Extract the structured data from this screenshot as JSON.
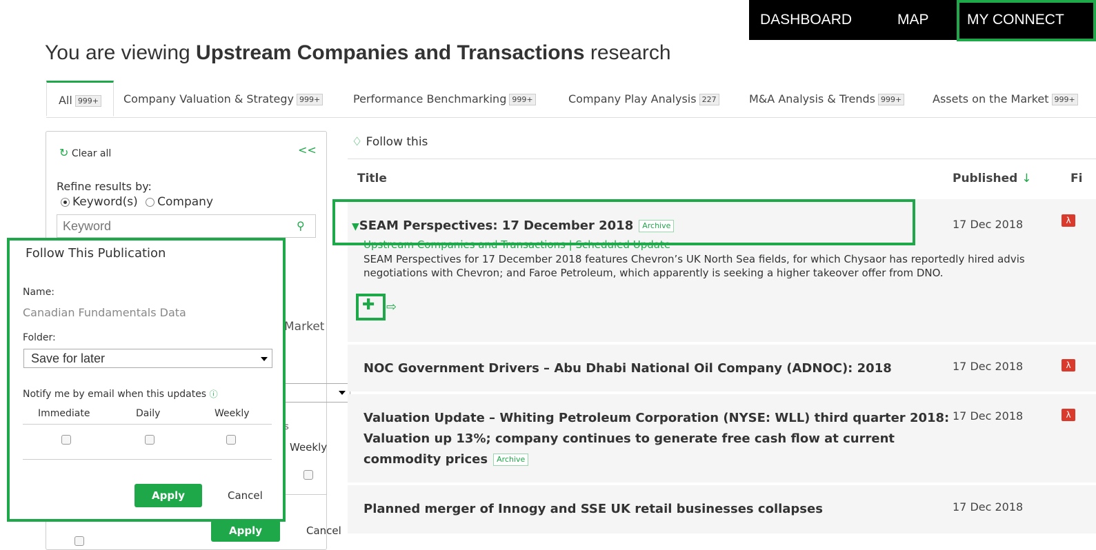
{
  "topnav": {
    "dashboard": "DASHBOARD",
    "map": "MAP",
    "my_connect": "MY CONNECT"
  },
  "heading": {
    "prefix": "You are viewing ",
    "bold": "Upstream Companies and Transactions",
    "suffix": " research"
  },
  "tabs": [
    {
      "label": "All",
      "count": "999+"
    },
    {
      "label": "Company Valuation & Strategy",
      "count": "999+"
    },
    {
      "label": "Performance Benchmarking",
      "count": "999+"
    },
    {
      "label": "Company Play Analysis",
      "count": "227"
    },
    {
      "label": "M&A Analysis & Trends",
      "count": "999+"
    },
    {
      "label": "Assets on the Market",
      "count": "999+"
    }
  ],
  "sidebar": {
    "clear_all": "Clear all",
    "collapse": "<<",
    "refine_label": "Refine results by:",
    "radio_keyword": "Keyword(s)",
    "radio_company": "Company",
    "keyword_placeholder": "Keyword",
    "hidden_market_text": "Market",
    "hidden_weekly": "Weekly",
    "hidden_info_s": "s",
    "apply": "Apply",
    "cancel": "Cancel"
  },
  "modal": {
    "title": "Follow This Publication",
    "name_label": "Name:",
    "name_value": "Canadian Fundamentals Data",
    "folder_label": "Folder:",
    "folder_value": "Save for later",
    "notify_label": "Notify me by email when this updates",
    "col_immediate": "Immediate",
    "col_daily": "Daily",
    "col_weekly": "Weekly",
    "apply": "Apply",
    "cancel": "Cancel"
  },
  "results": {
    "follow_this": "Follow this",
    "col_title": "Title",
    "col_published": "Published",
    "col_fi": "Fi",
    "archive_badge": "Archive",
    "rows": [
      {
        "title": "SEAM Perspectives: 17 December 2018",
        "subtitle": "Upstream Companies and Transactions | Scheduled Update",
        "summary_1": "SEAM Perspectives for 17 December 2018 features Chevron’s UK North Sea fields, for which Chysaor has reportedly hired advis",
        "summary_2": "negotiations with Chevron; and Faroe Petroleum, which apparently is seeking a higher takeover offer from DNO.",
        "date": "17 Dec 2018"
      },
      {
        "title": "NOC Government Drivers – Abu Dhabi National Oil Company (ADNOC): 2018",
        "date": "17 Dec 2018"
      },
      {
        "title_1": "Valuation Update – Whiting Petroleum Corporation (NYSE: WLL) third quarter 2018:",
        "title_2": "Valuation up 13%; company continues to generate free cash flow at current",
        "title_3": "commodity prices",
        "date": "17 Dec 2018"
      },
      {
        "title": "Planned merger of Innogy and SSE UK retail businesses collapses",
        "date": "17 Dec 2018"
      }
    ]
  },
  "colors": {
    "accent": "#1fa84a",
    "pdf": "#d93a2b"
  }
}
